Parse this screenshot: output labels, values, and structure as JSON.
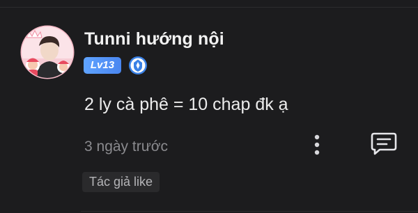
{
  "comment": {
    "username": "Tunni hướng nội",
    "level": "Lv13",
    "text": "2 ly cà phê = 10 chap đk ạ",
    "timestamp": "3 ngày trước",
    "author_like_label": "Tác giả like"
  },
  "icons": {
    "avatar": "avatar-image",
    "badge": "blue-shield-badge-icon",
    "more": "more-vertical-icon",
    "reply": "comment-reply-icon"
  },
  "colors": {
    "background": "#1c1c1e",
    "level_badge": "#5fa3ff",
    "muted_text": "#8a8a8e"
  }
}
